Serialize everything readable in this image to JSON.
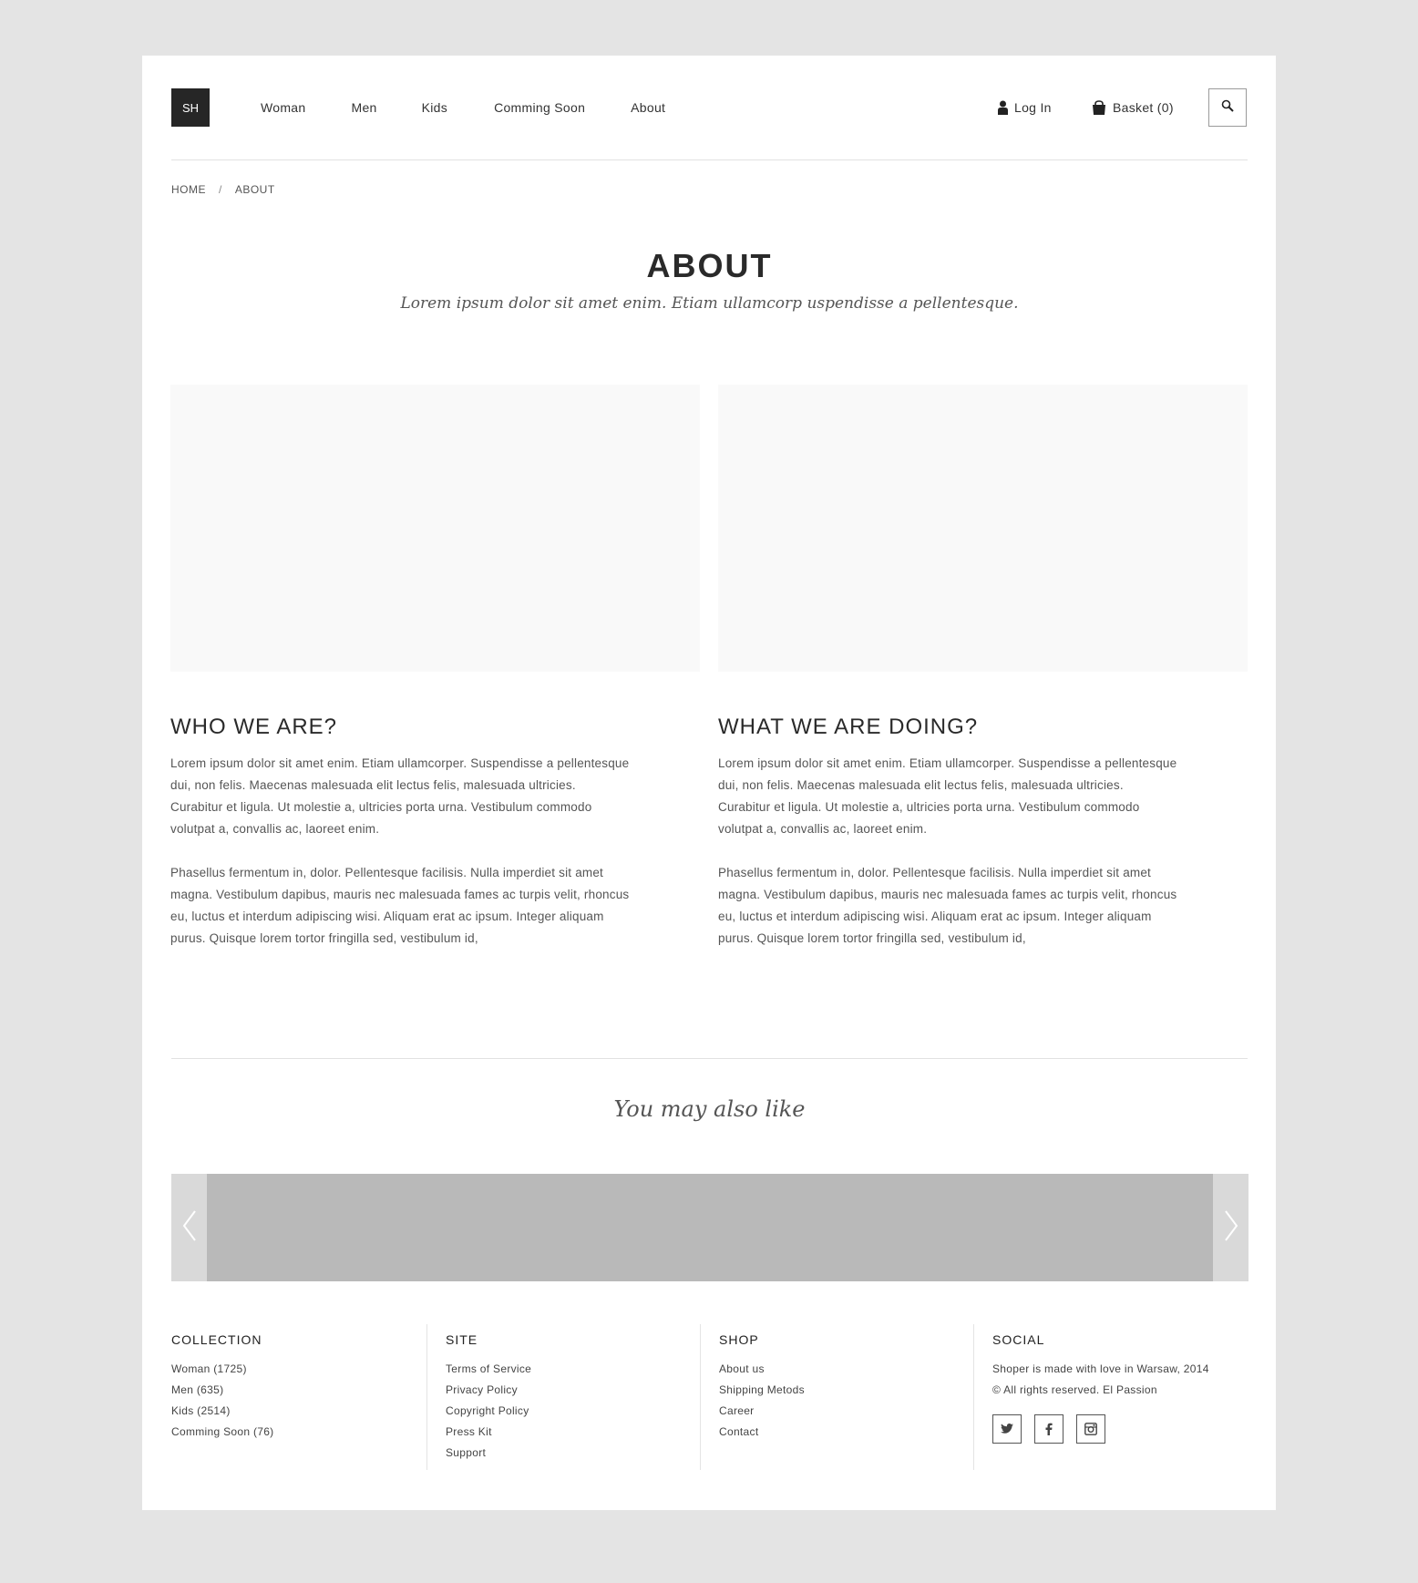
{
  "header": {
    "logo": "SH",
    "nav": [
      "Woman",
      "Men",
      "Kids",
      "Comming Soon",
      "About"
    ],
    "login": "Log In",
    "basket": "Basket (0)"
  },
  "breadcrumb": {
    "home": "HOME",
    "separator": "/",
    "current": "ABOUT"
  },
  "hero": {
    "title": "ABOUT",
    "subtitle": "Lorem ipsum dolor sit amet enim. Etiam ullamcorp uspendisse a pellentesque."
  },
  "sections": [
    {
      "heading": "WHO WE ARE?",
      "p1": "Lorem ipsum dolor sit amet enim. Etiam ullamcorper. Suspendisse a pellentesque dui, non felis. Maecenas malesuada elit lectus felis, malesuada ultricies. Curabitur et ligula. Ut molestie a, ultricies porta urna. Vestibulum commodo volutpat a, convallis ac, laoreet enim.",
      "p2": "Phasellus fermentum in, dolor. Pellentesque facilisis. Nulla imperdiet sit amet magna. Vestibulum dapibus, mauris nec malesuada fames ac turpis velit, rhoncus eu, luctus et interdum adipiscing wisi. Aliquam erat ac ipsum. Integer aliquam purus. Quisque lorem tortor fringilla sed, vestibulum id,"
    },
    {
      "heading": "WHAT WE ARE DOING?",
      "p1": "Lorem ipsum dolor sit amet enim. Etiam ullamcorper. Suspendisse a pellentesque dui, non felis. Maecenas malesuada elit lectus felis, malesuada ultricies. Curabitur et ligula. Ut molestie a, ultricies porta urna. Vestibulum commodo volutpat a, convallis ac, laoreet enim.",
      "p2": "Phasellus fermentum in, dolor. Pellentesque facilisis. Nulla imperdiet sit amet magna. Vestibulum dapibus, mauris nec malesuada fames ac turpis velit, rhoncus eu, luctus et interdum adipiscing wisi. Aliquam erat ac ipsum. Integer aliquam purus. Quisque lorem tortor fringilla sed, vestibulum id,"
    }
  ],
  "also_like": {
    "title": "You may also like"
  },
  "footer": {
    "collection": {
      "heading": "COLLECTION",
      "items": [
        "Woman (1725)",
        "Men (635)",
        "Kids (2514)",
        "Comming Soon (76)"
      ]
    },
    "site": {
      "heading": "SITE",
      "items": [
        "Terms of Service",
        "Privacy Policy",
        "Copyright Policy",
        "Press Kit",
        "Support"
      ]
    },
    "shop": {
      "heading": "SHOP",
      "items": [
        "About us",
        "Shipping Metods",
        "Career",
        "Contact"
      ]
    },
    "social": {
      "heading": "SOCIAL",
      "text": "Shoper is made with love in Warsaw, 2014 © All rights reserved. El Passion",
      "icons": [
        "twitter-icon",
        "facebook-icon",
        "instagram-icon"
      ]
    }
  },
  "colors": {
    "logo_bg": "#262626",
    "page_bg": "#e4e4e4",
    "carousel_track": "#b9b9b9"
  }
}
